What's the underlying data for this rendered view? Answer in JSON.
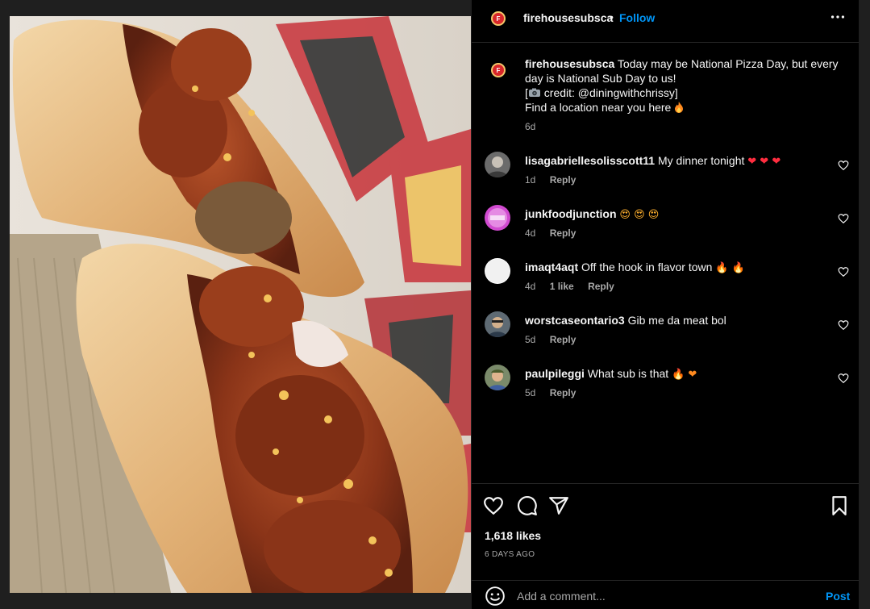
{
  "post": {
    "username": "firehousesubsca",
    "follow_label": "Follow",
    "separator": "•",
    "brand_initial": "F",
    "caption_line1": "Today may be National Pizza Day, but every",
    "caption_line2": "day is National Sub Day to us!",
    "caption_credit_open": "[",
    "caption_credit_text": " credit: @diningwithchrissy]",
    "caption_line4": "Find a location near you here",
    "caption_time": "6d"
  },
  "comments": [
    {
      "user": "lisagabriellesolisscott11",
      "text": "My dinner tonight",
      "emoji": "❤ ❤ ❤",
      "emoji_kind": "red",
      "time": "1d",
      "likes": "",
      "reply": "Reply"
    },
    {
      "user": "junkfoodjunction",
      "text": "",
      "emoji": "😍 😍 😍",
      "emoji_kind": "heye",
      "time": "4d",
      "likes": "",
      "reply": "Reply"
    },
    {
      "user": "imaqt4aqt",
      "text": "Off the hook in flavor town",
      "emoji": "🔥 🔥",
      "emoji_kind": "fire",
      "time": "4d",
      "likes": "1 like",
      "reply": "Reply"
    },
    {
      "user": "worstcaseontario3",
      "text": "Gib me da meat bol",
      "emoji": "",
      "emoji_kind": "",
      "time": "5d",
      "likes": "",
      "reply": "Reply"
    },
    {
      "user": "paulpileggi",
      "text": "What sub is that",
      "emoji": "🔥 ❤",
      "emoji_kind": "mixed",
      "time": "5d",
      "likes": "",
      "reply": "Reply"
    }
  ],
  "actions": {
    "likes": "1,618 likes",
    "posted_ago": "6 DAYS AGO"
  },
  "add_comment": {
    "placeholder": "Add a comment...",
    "post_label": "Post"
  },
  "colors": {
    "accent": "#0095f6",
    "background": "#000000",
    "secondary_text": "#a8a8a8",
    "brand_red": "#d8262a"
  }
}
